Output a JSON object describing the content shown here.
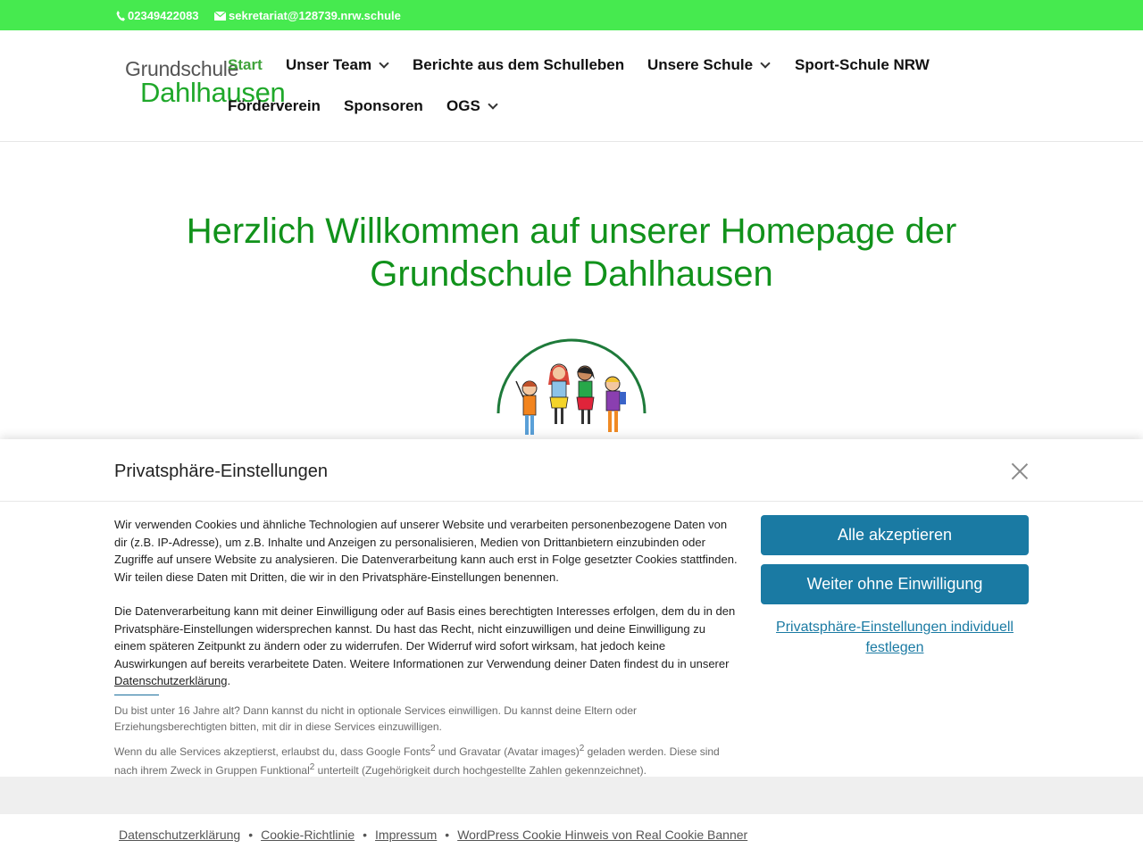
{
  "topbar": {
    "phone": "02349422083",
    "email": "sekretariat@128739.nrw.schule"
  },
  "logo": {
    "line1": "Grundschule",
    "line2": "Dahlhausen"
  },
  "nav": {
    "start": "Start",
    "unser_team": "Unser Team",
    "berichte": "Berichte aus dem Schulleben",
    "unsere_schule": "Unsere Schule",
    "sport_schule": "Sport-Schule NRW",
    "foerderverein": "Förderverein",
    "sponsoren": "Sponsoren",
    "ogs": "OGS"
  },
  "hero": {
    "title": "Herzlich Willkommen auf unserer Homepage der Grundschule Dahlhausen"
  },
  "cookie_banner": {
    "title": "Privatsphäre-Einstellungen",
    "paragraph1": "Wir verwenden Cookies und ähnliche Technologien auf unserer Website und verarbeiten personenbezogene Daten von dir (z.B. IP-Adresse), um z.B. Inhalte und Anzeigen zu personalisieren, Medien von Drittanbietern einzubinden oder Zugriffe auf unsere Website zu analysieren. Die Datenverarbeitung kann auch erst in Folge gesetzter Cookies stattfinden. Wir teilen diese Daten mit Dritten, die wir in den Privatsphäre-Einstellungen benennen.",
    "paragraph2": "Die Datenverarbeitung kann mit deiner Einwilligung oder auf Basis eines berechtigten Interesses erfolgen, dem du in den Privatsphäre-Einstellungen widersprechen kannst. Du hast das Recht, nicht einzuwilligen und deine Einwilligung zu einem späteren Zeitpunkt zu ändern oder zu widerrufen. Der Widerruf wird sofort wirksam, hat jedoch keine Auswirkungen auf bereits verarbeitete Daten. Weitere Informationen zur Verwendung deiner Daten findest du in unserer",
    "privacy_link": "Datenschutzerklärung",
    "period": ".",
    "under16": "Du bist unter 16 Jahre alt? Dann kannst du nicht in optionale Services einwilligen. Du kannst deine Eltern oder Erziehungsberechtigten bitten, mit dir in diese Services einzuwilligen.",
    "services_a": "Wenn du alle Services akzeptierst, erlaubst du, dass Google Fonts",
    "services_b": " und Gravatar (Avatar images)",
    "services_c": " geladen werden. Diese sind nach ihrem Zweck in Gruppen Funktional",
    "services_d": " unterteilt (Zugehörigkeit durch hochgestellte Zahlen gekennzeichnet).",
    "sup": "2",
    "accept_all": "Alle akzeptieren",
    "continue_without": "Weiter ohne Einwilligung",
    "individual": "Privatsphäre-Einstellungen individuell festlegen"
  },
  "footer": {
    "links": [
      "Datenschutzerklärung",
      "Cookie-Richtlinie",
      "Impressum",
      "WordPress Cookie Hinweis von Real Cookie Banner"
    ],
    "separator": "•"
  },
  "colors": {
    "topbar": "#46ea4f",
    "heading_green": "#11921b",
    "button_blue": "#1a7aa3"
  }
}
